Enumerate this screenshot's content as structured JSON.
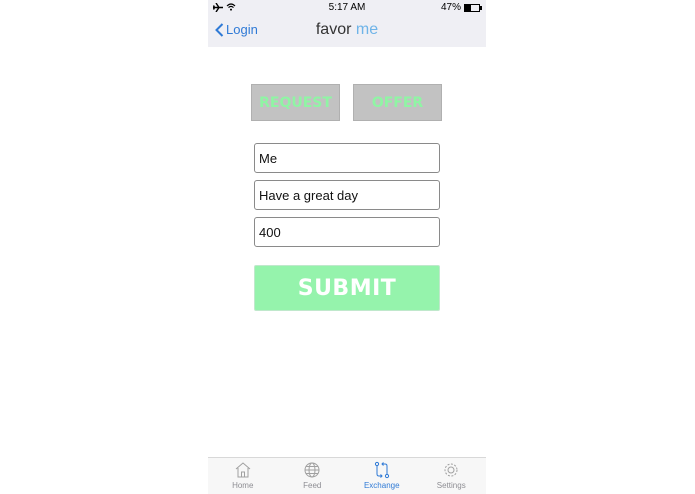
{
  "status": {
    "left_icons": "✈ ︎",
    "time": "5:17 AM",
    "battery": "47%"
  },
  "nav": {
    "back_label": "Login",
    "title_main": "favor",
    "title_accent": "me"
  },
  "toggles": {
    "request_label": "REQUEST",
    "offer_label": "OFFER"
  },
  "form": {
    "field1_value": "Me",
    "field2_value": "Have a great day",
    "field3_value": "400",
    "submit_label": "SUBMIT"
  },
  "tabs": [
    {
      "label": "Home",
      "icon": "home-icon"
    },
    {
      "label": "Feed",
      "icon": "globe-icon"
    },
    {
      "label": "Exchange",
      "icon": "exchange-icon"
    },
    {
      "label": "Settings",
      "icon": "gear-icon"
    }
  ],
  "colors": {
    "accent_blue": "#2f7ad6",
    "accent_green": "#95f3ac",
    "toggle_bg": "#c2c2c2"
  }
}
